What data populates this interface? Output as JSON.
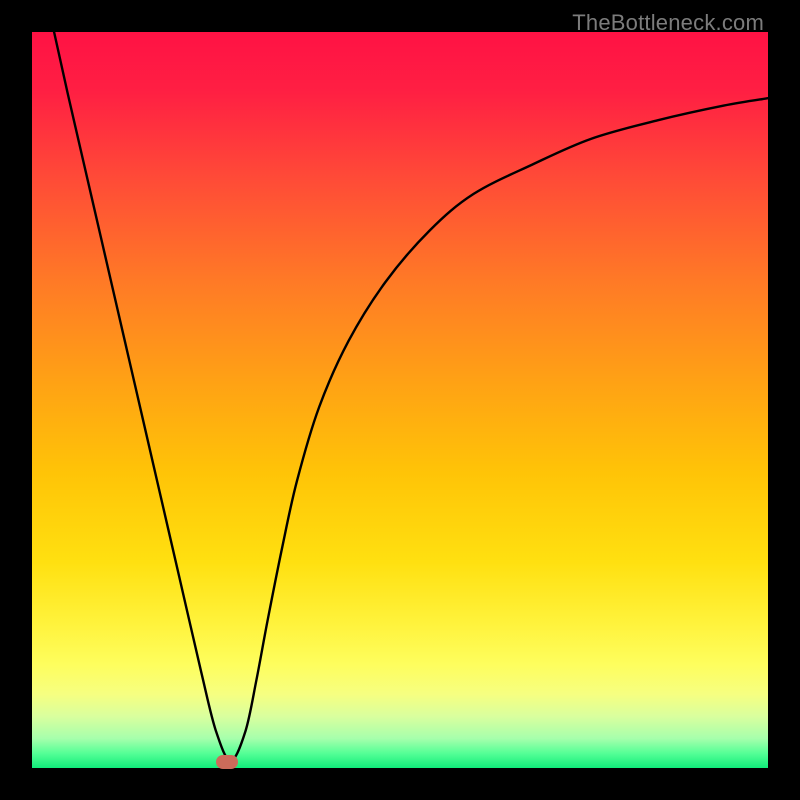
{
  "watermark": "TheBottleneck.com",
  "colors": {
    "frame": "#000000",
    "curve": "#000000",
    "marker": "#CC6B5A",
    "gradient_top": "#FF1244",
    "gradient_bottom": "#11EC7A",
    "watermark": "#7C7C7C"
  },
  "chart_data": {
    "type": "line",
    "title": "",
    "xlabel": "",
    "ylabel": "",
    "xlim": [
      0,
      100
    ],
    "ylim": [
      0,
      100
    ],
    "grid": false,
    "series": [
      {
        "name": "bottleneck-curve",
        "x": [
          3,
          5,
          8,
          11,
          14,
          17,
          20,
          23,
          25,
          27,
          29,
          30.5,
          32,
          34,
          36,
          39,
          43,
          48,
          54,
          60,
          68,
          76,
          85,
          94,
          100
        ],
        "y": [
          100,
          91,
          78,
          65,
          52,
          39,
          26,
          13,
          5,
          1,
          5,
          12,
          20,
          30,
          39,
          49,
          58,
          66,
          73,
          78,
          82,
          85.5,
          88,
          90,
          91
        ]
      }
    ],
    "annotations": [
      {
        "name": "curve-minimum-marker",
        "x": 26.5,
        "y": 0.8
      }
    ]
  }
}
